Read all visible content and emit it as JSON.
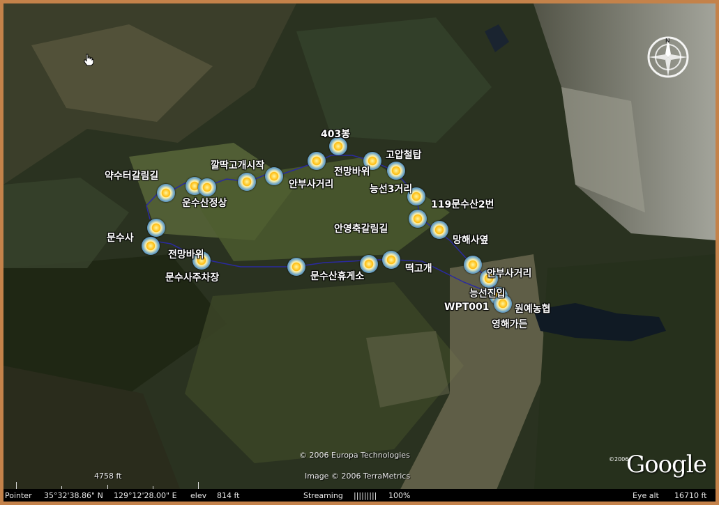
{
  "map": {
    "waypoints": [
      {
        "id": "wp-403bong",
        "label": "403봉"
      },
      {
        "id": "wp-goap",
        "label": "고압철탑"
      },
      {
        "id": "wp-jeonmang1",
        "label": "전망바위"
      },
      {
        "id": "wp-neungseon3",
        "label": "능선3거리"
      },
      {
        "id": "wp-kkalttak",
        "label": "깔딱고개시작"
      },
      {
        "id": "wp-anbu1",
        "label": "안부사거리"
      },
      {
        "id": "wp-yaksu",
        "label": "약수터갈림길"
      },
      {
        "id": "wp-summit",
        "label": "운수산정상"
      },
      {
        "id": "wp-119",
        "label": "119문수산2번"
      },
      {
        "id": "wp-anyeong",
        "label": "안영축갈림길"
      },
      {
        "id": "wp-munsusa",
        "label": "문수사"
      },
      {
        "id": "wp-manghae",
        "label": "망해사옆"
      },
      {
        "id": "wp-jeonmang2",
        "label": "전망바위"
      },
      {
        "id": "wp-parking",
        "label": "문수사주차장"
      },
      {
        "id": "wp-rest",
        "label": "문수산휴게소"
      },
      {
        "id": "wp-ttukgogae",
        "label": "떡고개"
      },
      {
        "id": "wp-anbu2",
        "label": "안부사거리"
      },
      {
        "id": "wp-neungseon-entry",
        "label": "능선진입"
      },
      {
        "id": "wp-wpt001",
        "label": "WPT001"
      },
      {
        "id": "wp-wonye",
        "label": "원예농협"
      },
      {
        "id": "wp-younghae",
        "label": "영해가든"
      }
    ],
    "extra_markers": 8,
    "credits": {
      "europa": "© 2006 Europa Technologies",
      "terrametrics": "Image © 2006 TerraMetrics",
      "google_year": "©2006",
      "google_logo": "Google"
    },
    "compass_label": "N",
    "scale_label": "4758 ft"
  },
  "status": {
    "pointer_label": "Pointer",
    "lat": "35°32'38.86\" N",
    "lon": "129°12'28.00\" E",
    "elev_label": "elev",
    "elev": "814 ft",
    "streaming_label": "Streaming",
    "streaming_bar": "|||||||||",
    "streaming_pct": "100%",
    "eye_label": "Eye alt",
    "eye_alt": "16710 ft"
  },
  "colors": {
    "frame": "#c4824a",
    "track": "#2a2aa0",
    "label": "#ffffff"
  },
  "icons": [
    "hand-cursor-icon",
    "compass-icon",
    "waypoint-icon"
  ]
}
